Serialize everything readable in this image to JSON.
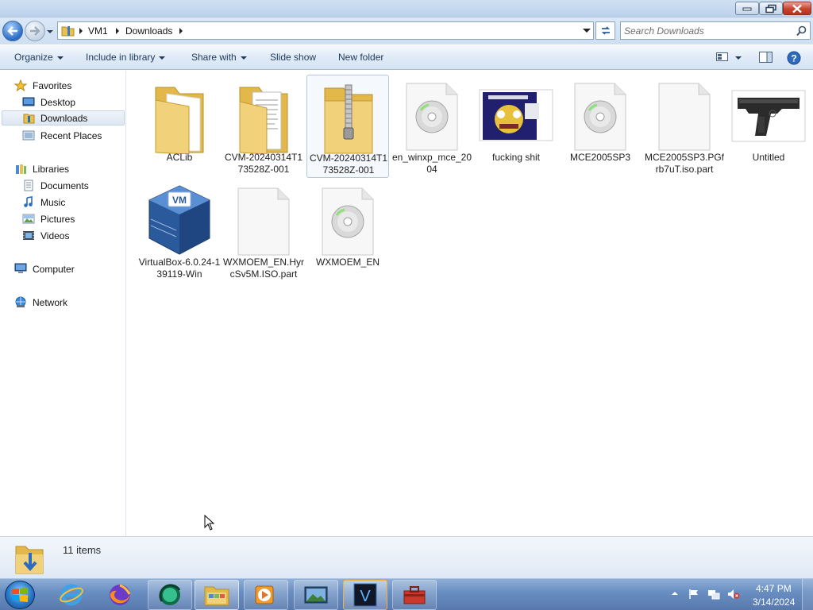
{
  "window": {
    "colors": {
      "accent": "#1e395b",
      "selection": "#dce7f3",
      "close": "#c7432e"
    }
  },
  "address": {
    "crumbs": [
      "VM1",
      "Downloads"
    ]
  },
  "search": {
    "placeholder": "Search Downloads"
  },
  "toolbar": {
    "organize": "Organize",
    "include_in_library": "Include in library",
    "share_with": "Share with",
    "slide_show": "Slide show",
    "new_folder": "New folder"
  },
  "nav": {
    "favorites": "Favorites",
    "desktop": "Desktop",
    "downloads": "Downloads",
    "recent_places": "Recent Places",
    "libraries": "Libraries",
    "documents": "Documents",
    "music": "Music",
    "pictures": "Pictures",
    "videos": "Videos",
    "computer": "Computer",
    "network": "Network"
  },
  "files": [
    {
      "name": "ACLib",
      "icon": "folder-icon"
    },
    {
      "name": "CVM-20240314T173528Z-001",
      "icon": "folder-with-documents-icon"
    },
    {
      "name": "CVM-20240314T173528Z-001",
      "icon": "zip-folder-icon"
    },
    {
      "name": "en_winxp_mce_2004",
      "icon": "disc-image-file-icon"
    },
    {
      "name": "fucking shit",
      "icon": "image-thumbnail-icon"
    },
    {
      "name": "MCE2005SP3",
      "icon": "disc-image-file-icon"
    },
    {
      "name": "MCE2005SP3.PGfrb7uT.iso.part",
      "icon": "blank-file-icon"
    },
    {
      "name": "Untitled",
      "icon": "pistol-image-thumbnail-icon"
    },
    {
      "name": "VirtualBox-6.0.24-139119-Win",
      "icon": "virtualbox-installer-icon"
    },
    {
      "name": "WXMOEM_EN.HyrcSv5M.ISO.part",
      "icon": "blank-file-icon"
    },
    {
      "name": "WXMOEM_EN",
      "icon": "disc-image-file-icon"
    }
  ],
  "details": {
    "item_count": "11 items"
  },
  "taskbar": {
    "pinned": [
      "internet-explorer-icon",
      "firefox-icon",
      "media-icon",
      "windows-explorer-icon",
      "media-player-icon",
      "image-viewer-icon",
      "v-app-icon",
      "toolbox-app-icon"
    ],
    "time": "4:47 PM",
    "date": "3/14/2024"
  }
}
